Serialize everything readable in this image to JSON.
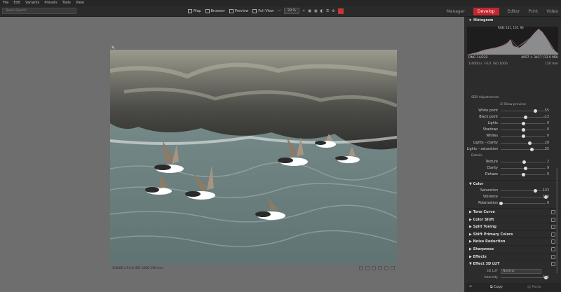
{
  "menu": [
    "File",
    "Edit",
    "Variants",
    "Presets",
    "Tools",
    "View"
  ],
  "search": {
    "placeholder": "Quick Search"
  },
  "views": [
    "Map",
    "Browser",
    "Preview",
    "Full View"
  ],
  "zoom": "29 %",
  "modules": [
    "Manager",
    "Develop",
    "Editor",
    "Print",
    "Video"
  ],
  "histogram": {
    "title": "Histogram",
    "rgb": "RGB: 101, 105, 96"
  },
  "file_info": {
    "format": "DNG",
    "count": "14/232",
    "dims": "4057 × 3417 (13.0 MB)",
    "shutter": "1/4000 s",
    "fstop": "F4.0",
    "iso": "ISO 1000",
    "focal": "150 mm"
  },
  "sdr": {
    "title": "SDR Adjustments",
    "show_preview": "Show preview"
  },
  "sliders": [
    {
      "label": "White point",
      "value": "55",
      "pos": 0.77
    },
    {
      "label": "Black point",
      "value": "-13",
      "pos": 0.55
    },
    {
      "label": "Lights",
      "value": "0",
      "pos": 0.5
    },
    {
      "label": "Shadows",
      "value": "0",
      "pos": 0.5
    },
    {
      "label": "Whites",
      "value": "0",
      "pos": 0.5
    },
    {
      "label": "Lights – clarity",
      "value": "28",
      "pos": 0.64
    },
    {
      "label": "Lights – saturation",
      "value": "35",
      "pos": 0.68
    }
  ],
  "details": {
    "title": "Details"
  },
  "detail_sliders": [
    {
      "label": "Texture",
      "value": "2",
      "pos": 0.51
    },
    {
      "label": "Clarity",
      "value": "9",
      "pos": 0.55
    },
    {
      "label": "Dehaze",
      "value": "0",
      "pos": 0.5
    }
  ],
  "color": {
    "title": "Color"
  },
  "color_sliders": [
    {
      "label": "Saturation",
      "value": "133",
      "pos": 0.77
    },
    {
      "label": "Vibrance",
      "value": "100",
      "pos": 1.0
    },
    {
      "label": "Polarization",
      "value": "0",
      "pos": 0.0
    }
  ],
  "sections": [
    "Tone Curve",
    "Color Shift",
    "Split Toning",
    "Shift Primary Colors",
    "Noise Reduction",
    "Sharpness",
    "Effects",
    "Effect 3D LUT"
  ],
  "lut": {
    "label": "3D LUT",
    "value": "Neutral",
    "intensity_label": "Intensity",
    "intensity": "100"
  },
  "photo_caption": "1/4000 s   F4.0   ISO 1000   150 mm",
  "bottom": {
    "copy": "Copy",
    "paste": "Paste"
  },
  "colors": {
    "accent": "#c2262e"
  }
}
